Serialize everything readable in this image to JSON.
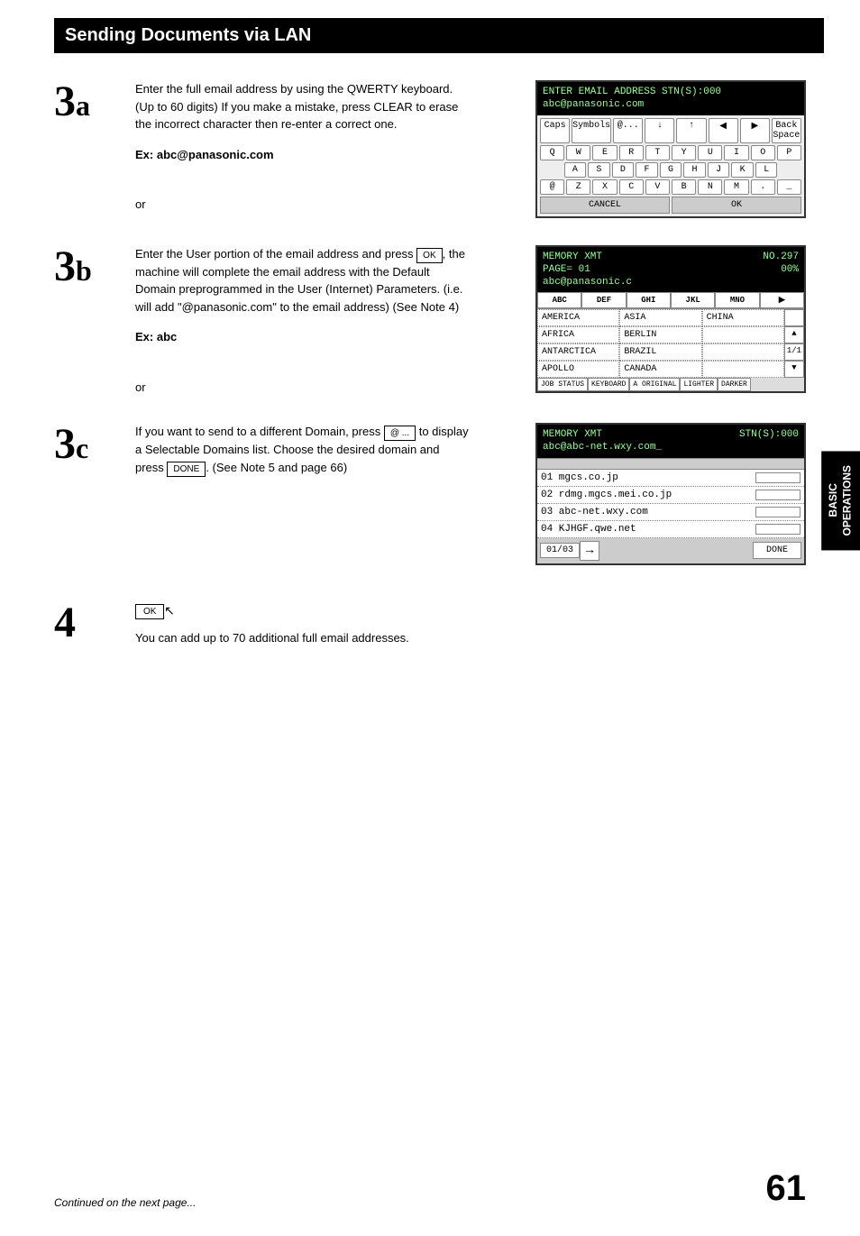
{
  "header": {
    "title": "Sending Documents via LAN"
  },
  "step3a": {
    "num": "3",
    "sub": "a",
    "body": "Enter the full email address by using the QWERTY keyboard.  (Up to 60 digits) If you make a mistake, press CLEAR to erase the incorrect character then re-enter a correct one.",
    "ex_label": "Ex: abc@panasonic.com",
    "or": "or"
  },
  "display3a": {
    "line1": "ENTER EMAIL ADDRESS STN(S):000",
    "line2": "abc@panasonic.com",
    "row0": [
      "Caps",
      "Symbols",
      "@...",
      "↓",
      "↑",
      "◀",
      "▶",
      "Back Space"
    ],
    "row1": [
      "Q",
      "W",
      "E",
      "R",
      "T",
      "Y",
      "U",
      "I",
      "O",
      "P"
    ],
    "row2": [
      "A",
      "S",
      "D",
      "F",
      "G",
      "H",
      "J",
      "K",
      "L"
    ],
    "row3": [
      "@",
      "Z",
      "X",
      "C",
      "V",
      "B",
      "N",
      "M",
      ".",
      "_"
    ],
    "cancel": "CANCEL",
    "ok": "OK"
  },
  "step3b": {
    "num": "3",
    "sub": "b",
    "body_pre": "Enter the User portion of the email address and press ",
    "ok_btn": "OK",
    "body_post": ", the machine will complete the email address with the Default Domain preprogrammed in the User (Internet) Parameters.  (i.e. will add \"@panasonic.com\" to the email address) (See Note 4)",
    "ex_label": "Ex: abc",
    "or": "or"
  },
  "display3b": {
    "line1": "MEMORY XMT",
    "line1_right": "NO.297",
    "line2": "PAGE=  01",
    "line2_right": "00%",
    "line3": "abc@panasonic.c",
    "abc_row": [
      "ABC",
      "DEF",
      "GHI",
      "JKL",
      "MNO",
      "▶"
    ],
    "locs": [
      [
        "AMERICA",
        "ASIA",
        "CHINA"
      ],
      [
        "AFRICA",
        "BERLIN",
        ""
      ],
      [
        "ANTARCTICA",
        "BRAZIL",
        ""
      ],
      [
        "APOLLO",
        "CANADA",
        ""
      ]
    ],
    "right_labels": [
      "",
      "▲",
      "1/1",
      "▼"
    ],
    "job_row": [
      "JOB STATUS",
      "KEYBOARD",
      "A ORIGINAL",
      "LIGHTER",
      "DARKER"
    ]
  },
  "step3c": {
    "num": "3",
    "sub": "c",
    "body_pre": "If you want to send to a different Domain, press ",
    "at_btn": "@ ...",
    "body_mid": " to display a Selectable Domains list.  Choose the desired domain and press ",
    "done_btn": "DONE",
    "body_post": ". (See Note 5 and page 66)"
  },
  "display3c": {
    "line1": "MEMORY XMT",
    "line1_right": "STN(S):000",
    "line2": "abc@abc-net.wxy.com_",
    "domains": [
      "01 mgcs.co.jp",
      "02 rdmg.mgcs.mei.co.jp",
      "03 abc-net.wxy.com",
      "04 KJHGF.qwe.net"
    ],
    "pager": "01/03",
    "arrow": "→",
    "done": "DONE"
  },
  "step4": {
    "num": "4",
    "ok_btn": "OK",
    "body": "You can add up to 70 additional full email addresses."
  },
  "side_tab": {
    "line1": "BASIC",
    "line2": "OPERATIONS"
  },
  "footer": {
    "text": "Continued on the next page...",
    "page": "61"
  }
}
